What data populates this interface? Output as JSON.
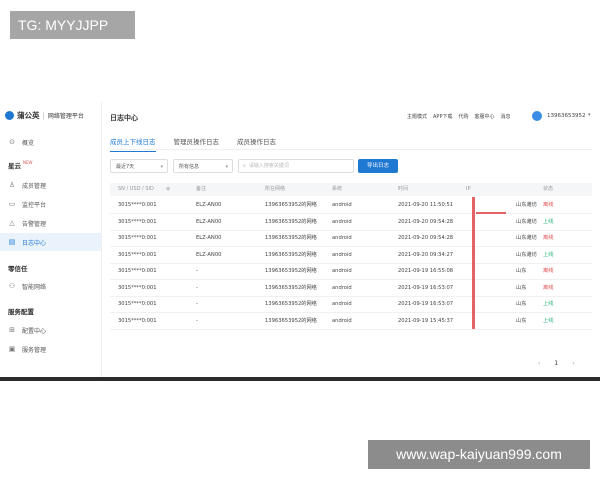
{
  "watermark_top": "TG: MYYJJPP",
  "watermark_bottom": "www.wap-kaiyuan999.com",
  "brand": {
    "name": "蒲公英",
    "subtitle": "网络管理平台"
  },
  "sidebar": {
    "overview": {
      "label": "概览",
      "icon": "overview-icon"
    },
    "group_xingyun": {
      "label": "星云",
      "tag": "NEW"
    },
    "items": [
      {
        "label": "成员管理",
        "icon": "members-icon"
      },
      {
        "label": "监控平台",
        "icon": "monitor-icon"
      },
      {
        "label": "告警管理",
        "icon": "alarm-icon"
      },
      {
        "label": "日志中心",
        "icon": "log-icon"
      }
    ],
    "group_zerotrust": {
      "label": "零信任"
    },
    "smart_network": {
      "label": "智能网络",
      "icon": "network-icon"
    },
    "group_service": {
      "label": "服务配置"
    },
    "service_items": [
      {
        "label": "配置中心",
        "icon": "config-icon"
      },
      {
        "label": "服务管理",
        "icon": "service-icon"
      }
    ]
  },
  "header": {
    "title": "日志中心",
    "menu": [
      "主题模式",
      "APP下载",
      "代购",
      "客服中心",
      "消息"
    ],
    "user_phone": "13963653952"
  },
  "tabs": [
    "成员上下线日志",
    "管理员操作日志",
    "成员操作日志"
  ],
  "filters": {
    "range": "最近7天",
    "type": "所有信息",
    "search_placeholder": "请输入搜索关键词",
    "export_label": "导出日志"
  },
  "table": {
    "columns": [
      "SN / USD / SID",
      "备注",
      "所在网络",
      "系统",
      "时间",
      "IP",
      "状态"
    ],
    "rows": [
      {
        "sn": "3015****0:001",
        "note": "ELZ-AN00",
        "network": "13963653952的网络",
        "system": "android",
        "time": "2021-09-20 11:50:51",
        "ip": "山东潍坊",
        "status": "离线"
      },
      {
        "sn": "3015****0:001",
        "note": "ELZ-AN00",
        "network": "13963653952的网络",
        "system": "android",
        "time": "2021-09-20 09:54:28",
        "ip": "山东潍坊",
        "status": "上线"
      },
      {
        "sn": "3015****0:001",
        "note": "ELZ-AN00",
        "network": "13963653952的网络",
        "system": "android",
        "time": "2021-09-20 09:54:28",
        "ip": "山东潍坊",
        "status": "离线"
      },
      {
        "sn": "3015****0:001",
        "note": "ELZ-AN00",
        "network": "13963653952的网络",
        "system": "android",
        "time": "2021-09-20 09:34:27",
        "ip": "山东潍坊",
        "status": "上线"
      },
      {
        "sn": "3015****0:001",
        "note": "-",
        "network": "13963653952的网络",
        "system": "android",
        "time": "2021-09-19 16:55:08",
        "ip": "山东",
        "status": "离线"
      },
      {
        "sn": "3015****0:001",
        "note": "-",
        "network": "13963653952的网络",
        "system": "android",
        "time": "2021-09-19 16:53:07",
        "ip": "山东",
        "status": "离线"
      },
      {
        "sn": "3015****0:001",
        "note": "-",
        "network": "13963653952的网络",
        "system": "android",
        "time": "2021-09-19 16:53:07",
        "ip": "山东",
        "status": "上线"
      },
      {
        "sn": "3015****0:001",
        "note": "-",
        "network": "13963653952的网络",
        "system": "android",
        "time": "2021-09-19 15:45:37",
        "ip": "山东",
        "status": "上线"
      }
    ]
  },
  "pagination": {
    "prev": "‹",
    "page": "1",
    "next": "›"
  },
  "colors": {
    "accent": "#1f78d1",
    "offline": "#e0484a",
    "online": "#2ab37a",
    "redaction": "#e0484a"
  }
}
